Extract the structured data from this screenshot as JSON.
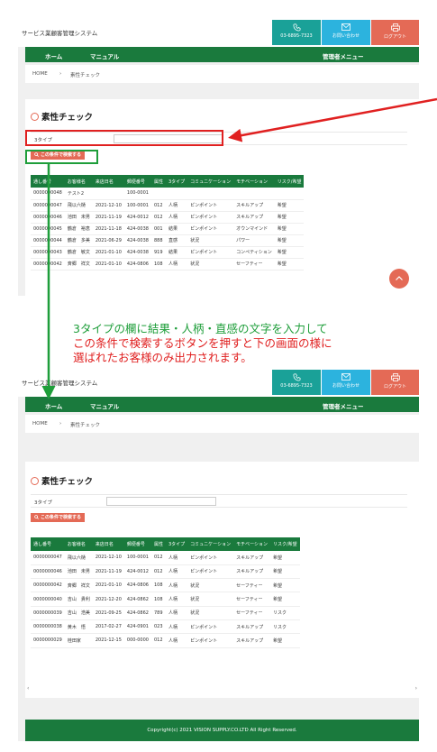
{
  "app": {
    "system_name": "サービス業顧客管理システム",
    "phone": "03-6895-7323",
    "contact_label": "お問い合わせ",
    "logout_label": "ログアウト"
  },
  "nav": {
    "home": "ホーム",
    "manual": "マニュアル",
    "admin": "管理者メニュー"
  },
  "breadcrumb": {
    "home": "HOME",
    "separator": "›",
    "current": "素性チェック"
  },
  "page": {
    "title": "素性チェック",
    "filter_label": "3タイプ",
    "filter_value": "",
    "search_button": "この条件で検索する"
  },
  "table": {
    "columns": [
      "通し番号",
      "お客様名",
      "来店日名",
      "郵便番号",
      "属性",
      "3タイプ",
      "コミュニケーション",
      "モチベーション",
      "リスク/希望"
    ]
  },
  "before_rows": [
    [
      "0000000048",
      "テスト2",
      "",
      "100-0001",
      "",
      "",
      "",
      "",
      ""
    ],
    [
      "0000000047",
      "飛以六樋",
      "2021-12-10",
      "100-0001",
      "012",
      "人柄",
      "ピンポイント",
      "スキルアップ",
      "希望"
    ],
    [
      "0000000046",
      "池田　未男",
      "2021-11-19",
      "424-0012",
      "012",
      "人柄",
      "ピンポイント",
      "スキルアップ",
      "希望"
    ],
    [
      "0000000045",
      "鶴倉　裕恵",
      "2021-11-18",
      "424-0038",
      "001",
      "結果",
      "ピンポイント",
      "オウンマインド",
      "希望"
    ],
    [
      "0000000044",
      "鶴倉　多美",
      "2021-06-29",
      "424-0038",
      "888",
      "直感",
      "状況",
      "パワー",
      "希望"
    ],
    [
      "0000000043",
      "鶴倉　敏文",
      "2021-01-10",
      "424-0038",
      "919",
      "結果",
      "ピンポイント",
      "コンペティション",
      "希望"
    ],
    [
      "0000000042",
      "斉郷　祥文",
      "2021-01-10",
      "424-0806",
      "108",
      "人柄",
      "状況",
      "セーフティー",
      "希望"
    ]
  ],
  "after_rows": [
    [
      "0000000047",
      "飛以六樋",
      "2021-12-10",
      "100-0001",
      "012",
      "人柄",
      "ピンポイント",
      "スキルアップ",
      "希望"
    ],
    [
      "0000000046",
      "池田　未男",
      "2021-11-19",
      "424-0012",
      "012",
      "人柄",
      "ピンポイント",
      "スキルアップ",
      "希望"
    ],
    [
      "0000000042",
      "斉郷　祥文",
      "2021-01-10",
      "424-0806",
      "108",
      "人柄",
      "状況",
      "セーフティー",
      "希望"
    ],
    [
      "0000000040",
      "吉山　貴利",
      "2021-12-20",
      "424-0862",
      "108",
      "人柄",
      "状況",
      "セーフティー",
      "希望"
    ],
    [
      "0000000039",
      "吉山　浩美",
      "2021-09-25",
      "424-0862",
      "789",
      "人柄",
      "状況",
      "セーフティー",
      "リスク"
    ],
    [
      "0000000038",
      "黄木　悟",
      "2017-02-27",
      "424-0901",
      "023",
      "人柄",
      "ピンポイント",
      "スキルアップ",
      "リスク"
    ],
    [
      "0000000029",
      "桂田家",
      "2021-12-15",
      "000-0000",
      "012",
      "人柄",
      "ピンポイント",
      "スキルアップ",
      "希望"
    ]
  ],
  "scrollbar": {
    "left": "‹",
    "right": "›"
  },
  "footer": {
    "copyright": "Copyright(c) 2021 VISION SUPPLY.CO.LTD All Right Reserved."
  },
  "annotation": {
    "line1": "3タイプの欄に結果・人柄・直感の文字を入力して",
    "line2": "この条件で検索するボタンを押すと下の画面の様に",
    "line3": "選ばれたお客様のみ出力されます。"
  },
  "colors": {
    "brand_green": "#1a7a3d",
    "accent_orange": "#e46a56",
    "teal": "#1aa198",
    "sky": "#2cb3de",
    "annotation_red": "#e02020",
    "annotation_green": "#1e9e3a"
  }
}
